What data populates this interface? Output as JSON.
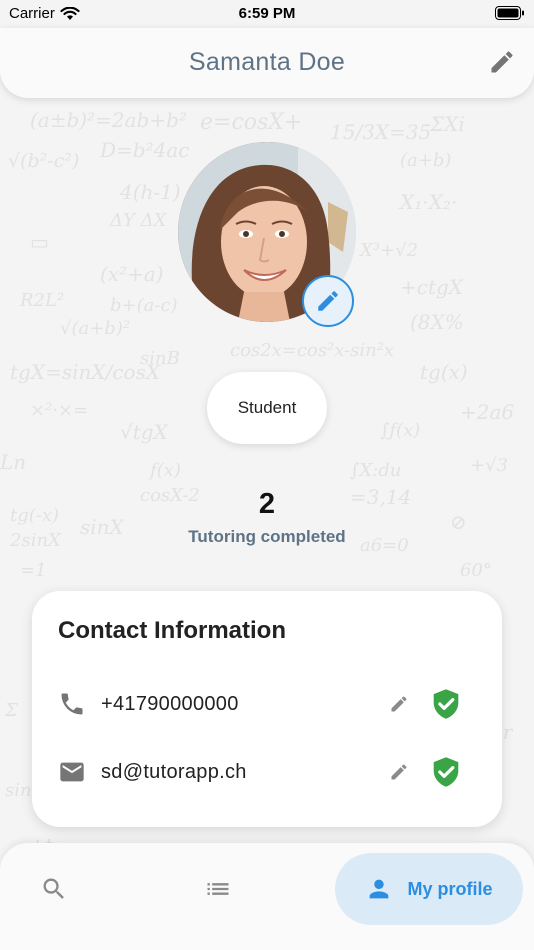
{
  "status_bar": {
    "carrier": "Carrier",
    "time": "6:59 PM"
  },
  "header": {
    "title": "Samanta Doe",
    "edit_icon": "pencil-icon"
  },
  "profile": {
    "avatar_alt": "profile-photo",
    "avatar_edit_icon": "pencil-icon",
    "role": "Student",
    "tutoring_count": "2",
    "tutoring_label": "Tutoring completed"
  },
  "contact": {
    "title": "Contact Information",
    "items": [
      {
        "icon": "phone-icon",
        "value": "+41790000000",
        "verified": true
      },
      {
        "icon": "email-icon",
        "value": "sd@tutorapp.ch",
        "verified": true
      }
    ]
  },
  "nav": {
    "items": [
      {
        "icon": "search-icon",
        "label": "",
        "active": false
      },
      {
        "icon": "list-icon",
        "label": "",
        "active": false
      },
      {
        "icon": "person-icon",
        "label": "My profile",
        "active": true
      }
    ]
  },
  "colors": {
    "accent": "#2d8ee0",
    "title_slate": "#5e7386",
    "verified_green": "#3aa547",
    "nav_active_bg": "#dbeaf7"
  }
}
